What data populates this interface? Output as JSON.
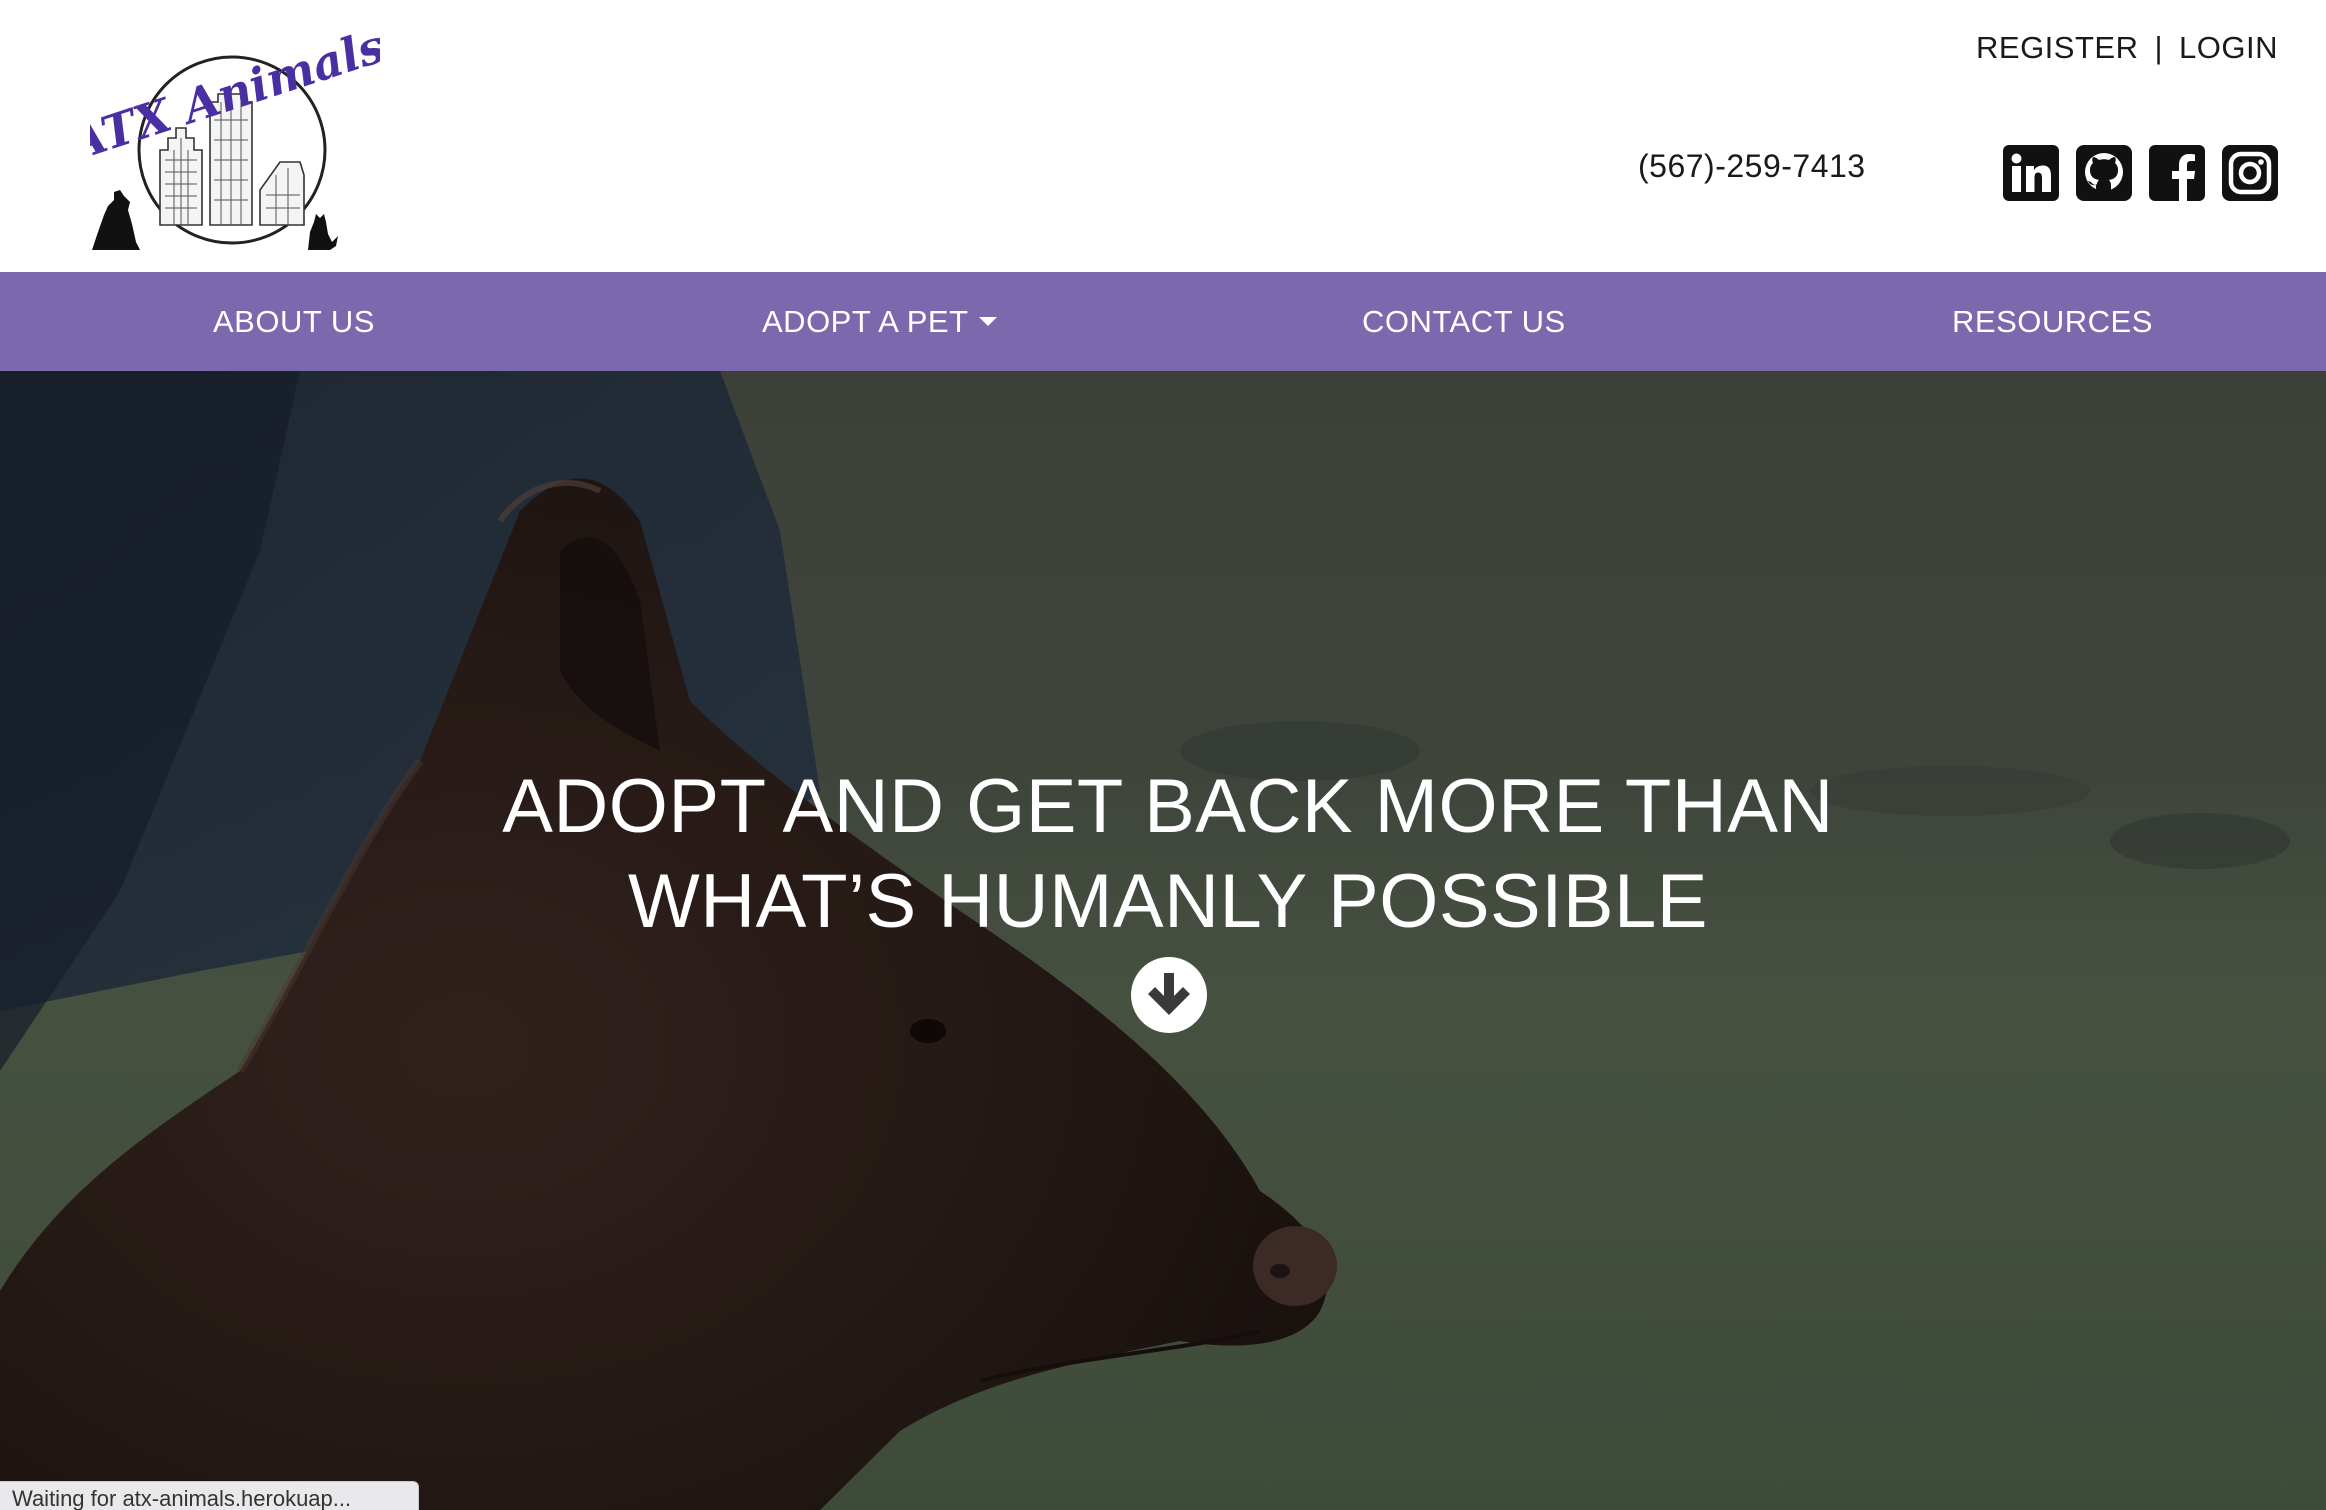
{
  "brand": {
    "logo_text": "ATX Animals",
    "accent_color": "#7b68ad",
    "logo_text_color": "#4a2fa3"
  },
  "auth": {
    "register": "REGISTER",
    "separator": "|",
    "login": "LOGIN"
  },
  "contact": {
    "phone": "(567)-259-7413"
  },
  "socials": [
    {
      "icon": "linkedin-icon"
    },
    {
      "icon": "github-icon"
    },
    {
      "icon": "facebook-icon"
    },
    {
      "icon": "instagram-icon"
    }
  ],
  "nav": {
    "about": "ABOUT US",
    "adopt": "ADOPT A PET",
    "contact": "CONTACT US",
    "resources": "RESOURCES"
  },
  "hero": {
    "line1": "ADOPT AND GET BACK MORE THAN",
    "line2": "WHAT’S HUMANLY POSSIBLE",
    "scroll_icon": "arrow-down-circle-icon"
  },
  "status_bar": {
    "text": "Waiting for atx-animals.herokuap..."
  }
}
